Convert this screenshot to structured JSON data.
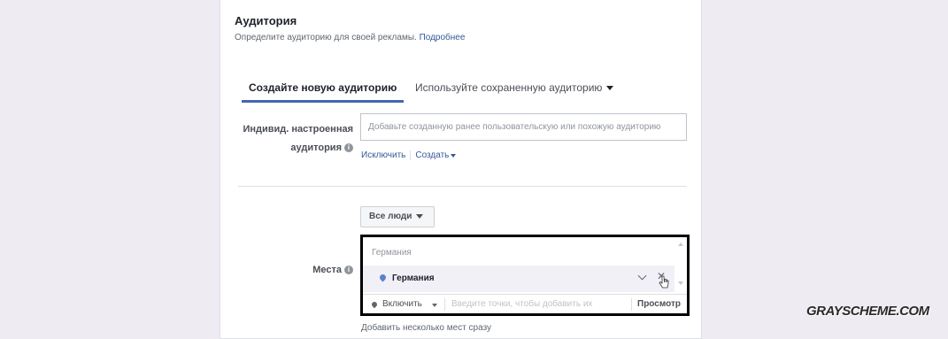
{
  "audience": {
    "title": "Аудитория",
    "subtitle": "Определите аудиторию для своей рекламы.",
    "learn_more": "Подробнее"
  },
  "tabs": [
    {
      "label": "Создайте новую аудиторию",
      "active": true
    },
    {
      "label": "Используйте сохраненную аудиторию",
      "active": false
    }
  ],
  "custom_audience": {
    "label_line1": "Индивид. настроенная",
    "label_line2": "аудитория",
    "placeholder": "Добавьте созданную ранее пользовательскую или похожую аудиторию",
    "exclude_link": "Исключить",
    "create_link": "Создать"
  },
  "locations": {
    "label": "Места",
    "people_dropdown": "Все люди",
    "hint": "Германия",
    "selected_location": "Германия",
    "include_dropdown": "Включить",
    "input_placeholder": "Введите точки, чтобы добавить их",
    "browse_button": "Просмотр",
    "add_multiple": "Добавить несколько мест сразу"
  },
  "watermark": "GRAYSCHEME.COM",
  "colors": {
    "accent": "#4267b2",
    "link": "#365899",
    "background": "#efebf3",
    "highlight_border": "#000000"
  }
}
